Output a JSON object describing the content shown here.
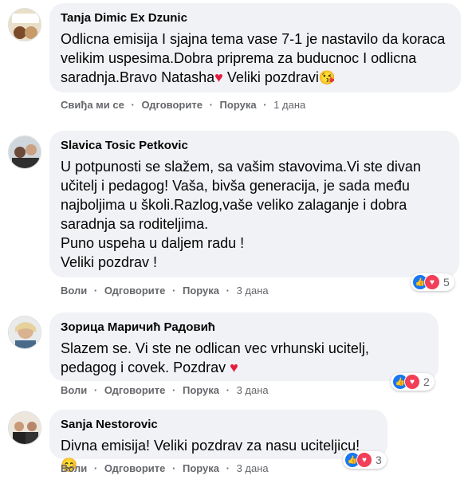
{
  "comments": [
    {
      "author": "Tanja Dimic Ex Dzunic",
      "text": "Odlicna emisija I sjajna tema vase 7-1 je nastavilo da koraca velikim uspesima.Dobra priprema za buducnoc I odlicna saradnja.Bravo Natasha",
      "text_tail": " Veliki pozdravi",
      "heart": "♥",
      "emoji": "😘",
      "like_label": "Свиђа ми се",
      "reply_label": "Одговорите",
      "message_label": "Порука",
      "time": "1 дана"
    },
    {
      "author": "Slavica Tosic Petkovic",
      "text": "U potpunosti se slažem, sa vašim stavovima.Vi ste divan učitelj i pedagog! Vaša, bivša generacija, je sada među najboljima u školi.Razlog,vaše veliko zalaganje i dobra saradnja sa roditeljima.\nPuno uspeha u daljem radu !\nVeliki pozdrav !",
      "like_label": "Воли",
      "reply_label": "Одговорите",
      "message_label": "Порука",
      "time": "3 дана",
      "reaction_count": "5"
    },
    {
      "author": "Зорица Маричић Радовић",
      "text": "Slazem se. Vi ste ne odlican vec vrhunski ucitelj, pedagog i covek. Pozdrav",
      "heart": "♥",
      "like_label": "Воли",
      "reply_label": "Одговорите",
      "message_label": "Порука",
      "time": "3 дана",
      "reaction_count": "2"
    },
    {
      "author": "Sanja Nestorovic",
      "text": "Divna emisija! Veliki pozdrav za nasu uciteljicu!",
      "emoji": "😊",
      "like_label": "Воли",
      "reply_label": "Одговорите",
      "message_label": "Порука",
      "time": "3 дана",
      "reaction_count": "3"
    }
  ],
  "separator": "·",
  "icons": {
    "like": "like-icon",
    "love": "love-icon"
  },
  "colors": {
    "bubble": "#f0f2f5",
    "meta": "#65676b",
    "like": "#1877f2",
    "love": "#f33e58"
  }
}
